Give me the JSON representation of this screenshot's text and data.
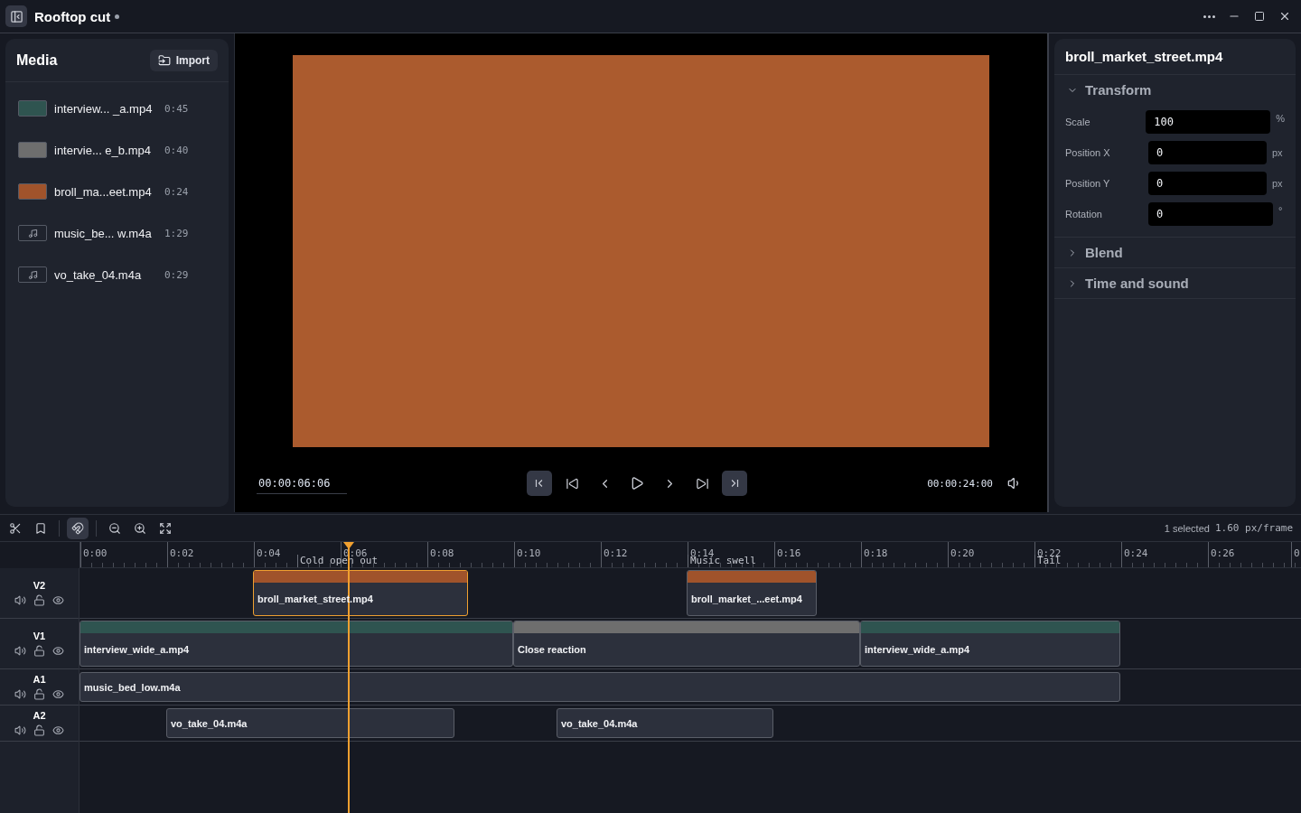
{
  "window": {
    "title": "Rooftop cut",
    "unsaved": true
  },
  "media": {
    "title": "Media",
    "import_button": "Import",
    "items": [
      {
        "name": "interview... _a.mp4",
        "duration": "0:45",
        "kind": "video",
        "color": "#2f5450"
      },
      {
        "name": "intervie... e_b.mp4",
        "duration": "0:40",
        "kind": "video",
        "color": "#6e6e6e"
      },
      {
        "name": "broll_ma...eet.mp4",
        "duration": "0:24",
        "kind": "video",
        "color": "#a0532b"
      },
      {
        "name": "music_be... w.m4a",
        "duration": "1:29",
        "kind": "audio"
      },
      {
        "name": "vo_take_04.m4a",
        "duration": "0:29",
        "kind": "audio"
      }
    ]
  },
  "preview": {
    "timecode": "00:00:06:06",
    "duration": "00:00:24:00",
    "controls": [
      {
        "kind": "mark-in",
        "highlighted": true
      },
      {
        "kind": "go-start",
        "highlighted": false
      },
      {
        "kind": "prev-frame",
        "highlighted": false
      },
      {
        "kind": "play",
        "highlighted": false
      },
      {
        "kind": "next-frame",
        "highlighted": false
      },
      {
        "kind": "go-end",
        "highlighted": false
      },
      {
        "kind": "mark-out",
        "highlighted": true
      }
    ]
  },
  "inspector": {
    "title": "broll_market_street.mp4",
    "sections": [
      {
        "title": "Transform",
        "expanded": true,
        "fields": [
          {
            "label": "Scale",
            "value": "100",
            "unit": "%"
          },
          {
            "label": "Position X",
            "value": "0",
            "unit": "px"
          },
          {
            "label": "Position Y",
            "value": "0",
            "unit": "px"
          },
          {
            "label": "Rotation",
            "value": "0",
            "unit": "°"
          }
        ]
      },
      {
        "title": "Blend",
        "expanded": false
      },
      {
        "title": "Time and sound",
        "expanded": false
      }
    ]
  },
  "timeline": {
    "tools": [
      {
        "kind": "cut",
        "on": false
      },
      {
        "kind": "marker",
        "on": false
      },
      {
        "kind": "snap",
        "on": true
      },
      {
        "kind": "zoom-out",
        "on": false
      },
      {
        "kind": "zoom-in",
        "on": false
      },
      {
        "kind": "fit",
        "on": false
      }
    ],
    "status": "1 selected",
    "scale": "1.60 px/frame",
    "ruler": [
      "0:00",
      "0:02",
      "0:04",
      "0:06",
      "0:08",
      "0:10",
      "0:12",
      "0:14",
      "0:16",
      "0:18",
      "0:20",
      "0:22",
      "0:24",
      "0:26",
      "0"
    ],
    "markers": [
      {
        "label": "Cold open out"
      },
      {
        "label": "Music swell"
      },
      {
        "label": "Tail"
      }
    ],
    "tracks": [
      {
        "name": "V2",
        "kind": "video",
        "clips": [
          {
            "name": "broll_market_street.mp4",
            "color": "#a0532b",
            "selected": true
          },
          {
            "name": "broll_market_...eet.mp4",
            "color": "#a0532b",
            "selected": false
          }
        ]
      },
      {
        "name": "V1",
        "kind": "video",
        "clips": [
          {
            "name": "interview_wide_a.mp4",
            "color": "#2f5450",
            "selected": false
          },
          {
            "name": "Close reaction",
            "color": "#6e6e6e",
            "selected": false
          },
          {
            "name": "interview_wide_a.mp4",
            "color": "#2f5450",
            "selected": false
          }
        ]
      },
      {
        "name": "A1",
        "kind": "audio",
        "clips": [
          {
            "name": "music_bed_low.m4a",
            "selected": false
          }
        ]
      },
      {
        "name": "A2",
        "kind": "audio",
        "clips": [
          {
            "name": "vo_take_04.m4a",
            "selected": false
          },
          {
            "name": "vo_take_04.m4a",
            "selected": false
          }
        ]
      }
    ]
  }
}
